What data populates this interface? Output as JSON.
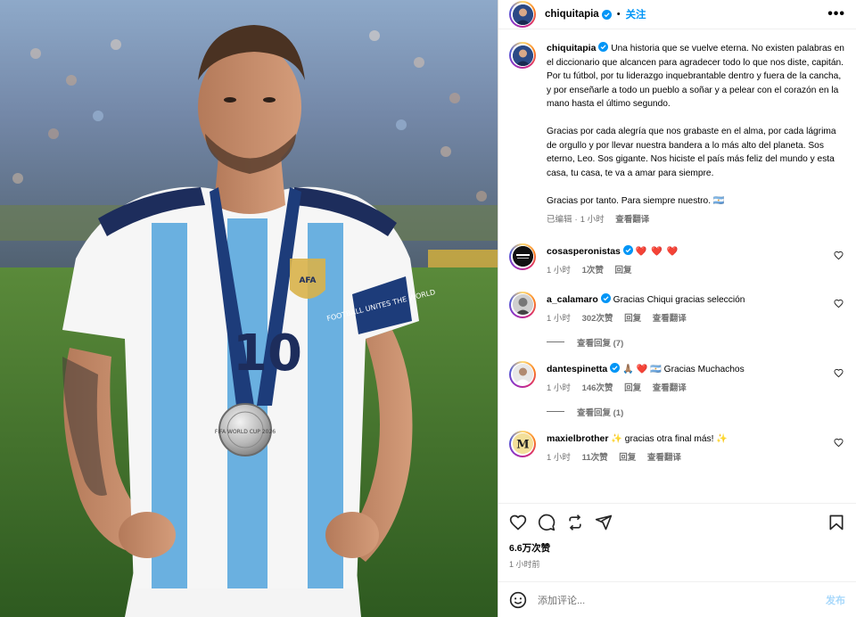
{
  "post": {
    "author": "chiquitapia",
    "follow_label": "关注",
    "dot": "•",
    "more": "•••"
  },
  "caption": {
    "author": "chiquitapia",
    "p1": "Una historia que se vuelve eterna. No existen palabras en el diccionario que alcancen para agradecer todo lo que nos diste, capitán. Por tu fútbol, por tu liderazgo inquebrantable dentro y fuera de la cancha, y por enseñarle a todo un pueblo a soñar y a pelear con el corazón en la mano hasta el último segundo.",
    "p2": "Gracias por cada alegría que nos grabaste en el alma, por cada lágrima de orgullo y por llevar nuestra bandera a lo más alto del planeta. Sos eterno, Leo. Sos gigante. Nos hiciste el país más feliz del mundo y esta casa, tu casa, te va a amar para siempre.",
    "p3": "Gracias por tanto. Para siempre nuestro. 🇦🇷",
    "edited": "已编辑",
    "sep": "·",
    "time": "1 小时",
    "translate": "查看翻译"
  },
  "comments": [
    {
      "user": "cosasperonistas",
      "text": "❤️ ❤️ ❤️",
      "time": "1 小时",
      "likes": "1次赞",
      "reply": "回复",
      "translate": ""
    },
    {
      "user": "a_calamaro",
      "text": "Gracias Chiqui gracias selección",
      "time": "1 小时",
      "likes": "302次赞",
      "reply": "回复",
      "translate": "查看翻译",
      "replies": "查看回复 (7)"
    },
    {
      "user": "dantespinetta",
      "text": "🙏🏽 ❤️ 🇦🇷 Gracias Muchachos",
      "time": "1 小时",
      "likes": "146次赞",
      "reply": "回复",
      "translate": "查看翻译",
      "replies": "查看回复 (1)"
    },
    {
      "user": "maxielbrother",
      "text": "✨ gracias otra final más! ✨",
      "time": "1 小时",
      "likes": "11次赞",
      "reply": "回复",
      "translate": "查看翻译"
    }
  ],
  "footer": {
    "likes": "6.6万次赞",
    "ago": "1 小时前",
    "placeholder": "添加评论...",
    "post_label": "发布"
  },
  "photo": {
    "medal_text": "FIFA WORLD CUP 2026",
    "badge_text": "AFA",
    "armband": "FOOTBALL UNITES THE WORLD",
    "number": "10"
  },
  "colors": {
    "accent": "#0095f6",
    "secondary_text": "#737373",
    "heart_red": "#ed4956"
  }
}
